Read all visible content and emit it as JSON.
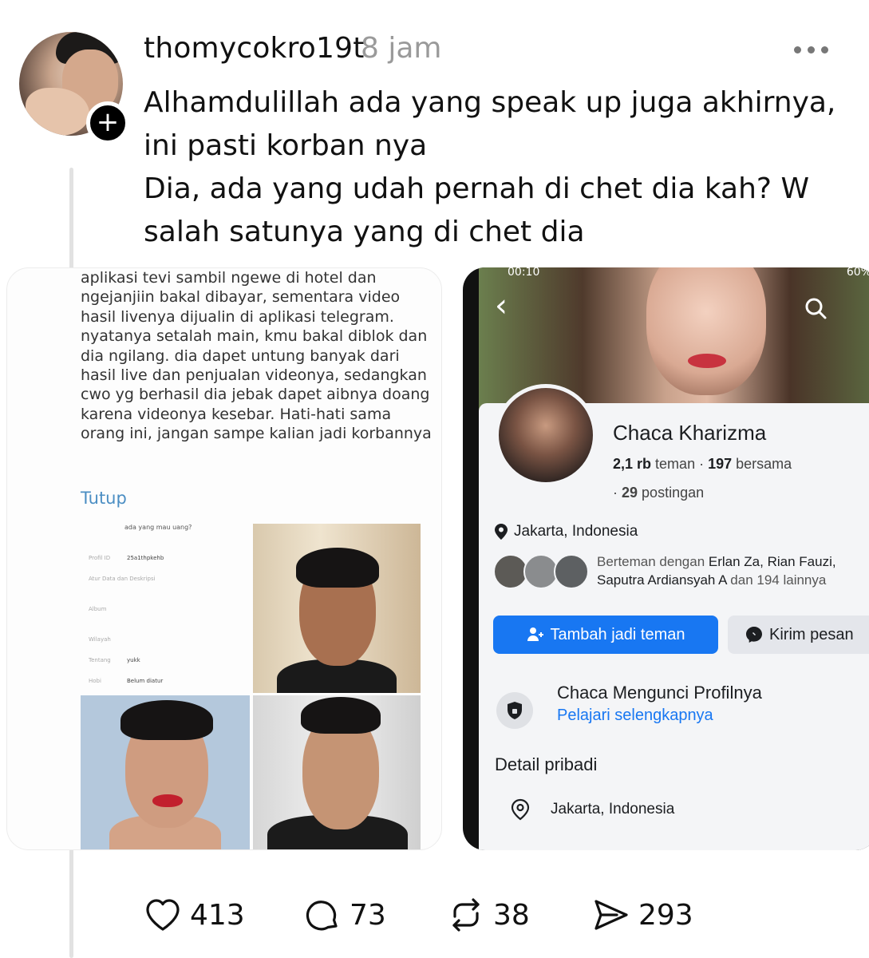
{
  "post": {
    "username": "thomycokro19t",
    "timestamp": "8 jam",
    "follow_symbol": "+",
    "text_lines": [
      "Alhamdulillah ada yang speak up juga akhirnya, ini pasti korban nya",
      "Dia, ada yang udah pernah di chet dia kah? W salah satunya yang di chet dia"
    ]
  },
  "left_image": {
    "quote_text": "aplikasi tevi sambil ngewe di hotel dan ngejanjiin bakal dibayar, sementara video hasil livenya dijualin di aplikasi telegram. nyatanya setalah main, kmu bakal diblok dan dia ngilang. dia dapet untung banyak dari hasil live dan penjualan videonya, sedangkan cwo yg berhasil dia jebak dapet aibnya doang karena videonya kesebar. Hati-hati sama orang ini, jangan sampe kalian jadi korbannya",
    "collapse_link": "Tutup",
    "profile": {
      "title": "ada yang mau uang?",
      "rows": [
        {
          "label": "Profil ID",
          "value": "25a1thpkehb"
        },
        {
          "label": "Atur Data dan Deskripsi",
          "value": ""
        },
        {
          "label": "Album",
          "value": ""
        },
        {
          "label": "Wilayah",
          "value": ""
        },
        {
          "label": "Tentang",
          "value": "yukk"
        },
        {
          "label": "Hobi",
          "value": "Belum diatur"
        }
      ]
    }
  },
  "right_image": {
    "status_left": "00:10",
    "status_right": "60%",
    "name": "Chaca Kharizma",
    "friends_count": "2,1 rb",
    "friends_label": "teman",
    "mutual_count": "197",
    "mutual_label": "bersama",
    "posts_count": "29",
    "posts_label": "postingan",
    "location": "Jakarta, Indonesia",
    "mutual_prefix": "Berteman dengan",
    "mutual_names": "Erlan Za, Rian Fauzi,",
    "mutual_line2_name": "Saputra Ardiansyah A",
    "mutual_line2_suffix": "dan 194 lainnya",
    "add_friend_label": "Tambah jadi teman",
    "message_label": "Kirim pesan",
    "locked_title": "Chaca Mengunci Profilnya",
    "locked_link": "Pelajari selengkapnya",
    "detail_title": "Detail pribadi",
    "detail_location": "Jakarta, Indonesia"
  },
  "actions": {
    "likes": "413",
    "replies": "73",
    "reposts": "38",
    "shares": "293"
  }
}
